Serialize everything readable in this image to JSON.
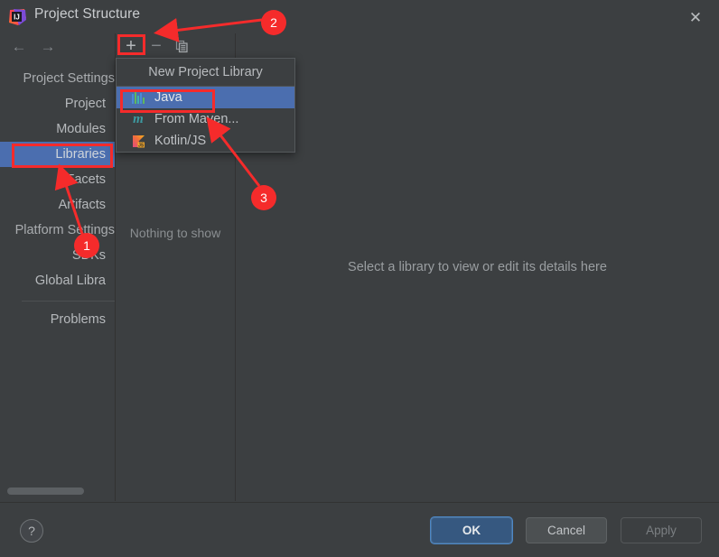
{
  "window": {
    "title": "Project Structure",
    "logo_icon": "intellij-idea-logo",
    "close_icon": "✕"
  },
  "sidebar": {
    "back_icon": "←",
    "forward_icon": "→",
    "groups": [
      {
        "label": "Project Settings"
      },
      {
        "label": "Platform Settings"
      }
    ],
    "items": [
      {
        "label": "Project",
        "selected": false
      },
      {
        "label": "Modules",
        "selected": false
      },
      {
        "label": "Libraries",
        "selected": true
      },
      {
        "label": "Facets",
        "selected": false
      },
      {
        "label": "Artifacts",
        "selected": false
      },
      {
        "label": "SDKs",
        "selected": false
      },
      {
        "label": "Global Libra",
        "selected": false
      },
      {
        "label": "Problems",
        "selected": false
      }
    ]
  },
  "toolbar": {
    "add_label": "+",
    "add_icon": "plus-icon",
    "remove_label": "−",
    "remove_icon": "minus-icon",
    "copy_icon": "copy-icon"
  },
  "library_list": {
    "empty_message": "Nothing to show"
  },
  "details": {
    "empty_message": "Select a library to view or edit its details here"
  },
  "popup": {
    "title": "New Project Library",
    "items": [
      {
        "label": "Java",
        "icon": "java-icon",
        "selected": true
      },
      {
        "label": "From Maven...",
        "icon": "maven-icon",
        "selected": false
      },
      {
        "label": "Kotlin/JS",
        "icon": "kotlin-js-icon",
        "selected": false
      }
    ]
  },
  "footer": {
    "help_label": "?",
    "ok_label": "OK",
    "cancel_label": "Cancel",
    "apply_label": "Apply"
  },
  "annotations": {
    "accent_color": "#f52b2b",
    "markers": [
      {
        "label": "1"
      },
      {
        "label": "2"
      },
      {
        "label": "3"
      }
    ]
  },
  "colors": {
    "background": "#3c3f41",
    "selection": "#4b6eaf",
    "ok_button": "#365880",
    "annotation": "#f52b2b"
  }
}
